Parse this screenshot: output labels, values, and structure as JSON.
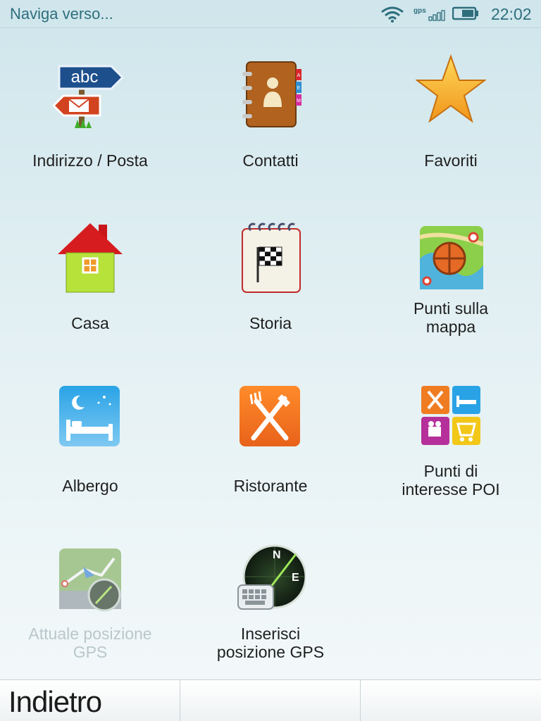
{
  "statusbar": {
    "title": "Naviga verso...",
    "gps_label": "gps",
    "time": "22:02",
    "icons": [
      "wifi-icon",
      "gps-signal-icon",
      "battery-icon"
    ]
  },
  "menu": {
    "items": [
      {
        "id": "indirizzo",
        "label": "Indirizzo / Posta",
        "icon": "address-signpost-icon",
        "sign_text": "abc",
        "enabled": true
      },
      {
        "id": "contatti",
        "label": "Contatti",
        "icon": "contacts-book-icon",
        "tabs": [
          "A",
          "E",
          "M"
        ],
        "enabled": true
      },
      {
        "id": "favoriti",
        "label": "Favoriti",
        "icon": "star-icon",
        "enabled": true
      },
      {
        "id": "casa",
        "label": "Casa",
        "icon": "house-icon",
        "enabled": true
      },
      {
        "id": "storia",
        "label": "Storia",
        "icon": "history-notepad-flag-icon",
        "enabled": true
      },
      {
        "id": "punti_mappa",
        "label_line1": "Punti sulla",
        "label_line2": "mappa",
        "icon": "map-compass-icon",
        "enabled": true
      },
      {
        "id": "albergo",
        "label": "Albergo",
        "icon": "hotel-bed-icon",
        "enabled": true
      },
      {
        "id": "ristorante",
        "label": "Ristorante",
        "icon": "restaurant-cutlery-icon",
        "enabled": true
      },
      {
        "id": "poi",
        "label_line1": "Punti di",
        "label_line2": "interesse POI",
        "icon": "poi-grid-icon",
        "enabled": true
      },
      {
        "id": "attuale",
        "label_line1": "Attuale posizione",
        "label_line2": "GPS",
        "icon": "current-position-map-icon",
        "enabled": false
      },
      {
        "id": "inserisci",
        "label_line1": "Inserisci",
        "label_line2": "posizione GPS",
        "icon": "gps-radar-keyboard-icon",
        "compass": [
          "N",
          "E"
        ],
        "enabled": true
      }
    ]
  },
  "softkeys": {
    "left": "Indietro",
    "middle": "",
    "right": ""
  },
  "colors": {
    "status_text": "#2f6e7d",
    "label_text": "#1f1f1f",
    "disabled_label": "#b9c7cb"
  }
}
